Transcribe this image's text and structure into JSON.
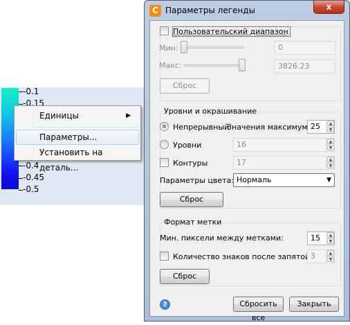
{
  "legend": {
    "ticks": [
      "-0.1",
      "-0.15",
      "-0.4",
      "-0.45",
      "-0.5"
    ]
  },
  "context_menu": {
    "items": [
      {
        "label": "Единицы",
        "has_submenu": true
      },
      {
        "label": "Параметры..."
      },
      {
        "label": "Установить на деталь..."
      }
    ]
  },
  "dialog": {
    "title": "Параметры легенды",
    "close_label": "x",
    "icon_letter": "C",
    "custom_range": {
      "checkbox_label": "Пользовательский диапазон",
      "min_label": "Мин:",
      "min_value": "0",
      "max_label": "Макс:",
      "max_value": "3826.23",
      "reset_label": "Сброс"
    },
    "levels": {
      "group_title": "Уровни и окрашивание",
      "continuous_label": "Непрерывный",
      "max_values_label": "Значения максимума:",
      "max_values_value": "25",
      "levels_label": "Уровни",
      "levels_value": "16",
      "contours_label": "Контуры",
      "contours_value": "17",
      "color_params_label": "Параметры цвета:",
      "color_params_value": "Нормаль",
      "reset_label": "Сброс"
    },
    "label_format": {
      "group_title": "Формат метки",
      "min_pixels_label": "Мин. пиксели между метками:",
      "min_pixels_value": "15",
      "decimals_label": "Количество знаков после запятой:",
      "decimals_value": "3",
      "reset_label": "Сброс"
    },
    "footer": {
      "help_icon": "?",
      "reset_all_label": "Сбросить все",
      "close_label": "Закрыть"
    }
  }
}
